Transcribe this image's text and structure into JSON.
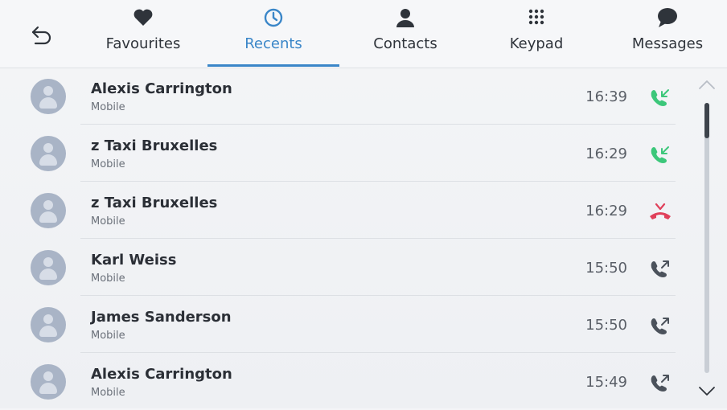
{
  "header": {
    "tabs": [
      {
        "id": "favourites",
        "label": "Favourites",
        "icon": "heart-icon"
      },
      {
        "id": "recents",
        "label": "Recents",
        "icon": "clock-icon",
        "active": true
      },
      {
        "id": "contacts",
        "label": "Contacts",
        "icon": "person-icon"
      },
      {
        "id": "keypad",
        "label": "Keypad",
        "icon": "keypad-icon"
      },
      {
        "id": "messages",
        "label": "Messages",
        "icon": "speech-bubble-icon"
      }
    ],
    "back_icon": "back-arrow-icon",
    "accent_color": "#3a86c8"
  },
  "recents": [
    {
      "name": "Alexis Carrington",
      "type": "Mobile",
      "time": "16:39",
      "call_status": "incoming",
      "status_icon": "incoming-call-icon",
      "status_color": "#3cc77a"
    },
    {
      "name": "z Taxi Bruxelles",
      "type": "Mobile",
      "time": "16:29",
      "call_status": "incoming",
      "status_icon": "incoming-call-icon",
      "status_color": "#3cc77a"
    },
    {
      "name": "z Taxi Bruxelles",
      "type": "Mobile",
      "time": "16:29",
      "call_status": "missed",
      "status_icon": "missed-call-icon",
      "status_color": "#e0405a"
    },
    {
      "name": "Karl Weiss",
      "type": "Mobile",
      "time": "15:50",
      "call_status": "outgoing",
      "status_icon": "outgoing-call-icon",
      "status_color": "#4b525b"
    },
    {
      "name": "James Sanderson",
      "type": "Mobile",
      "time": "15:50",
      "call_status": "outgoing",
      "status_icon": "outgoing-call-icon",
      "status_color": "#4b525b"
    },
    {
      "name": "Alexis Carrington",
      "type": "Mobile",
      "time": "15:49",
      "call_status": "outgoing",
      "status_icon": "outgoing-call-icon",
      "status_color": "#4b525b"
    }
  ],
  "scrollbar": {
    "up_icon": "chevron-up-icon",
    "down_icon": "chevron-down-icon"
  }
}
